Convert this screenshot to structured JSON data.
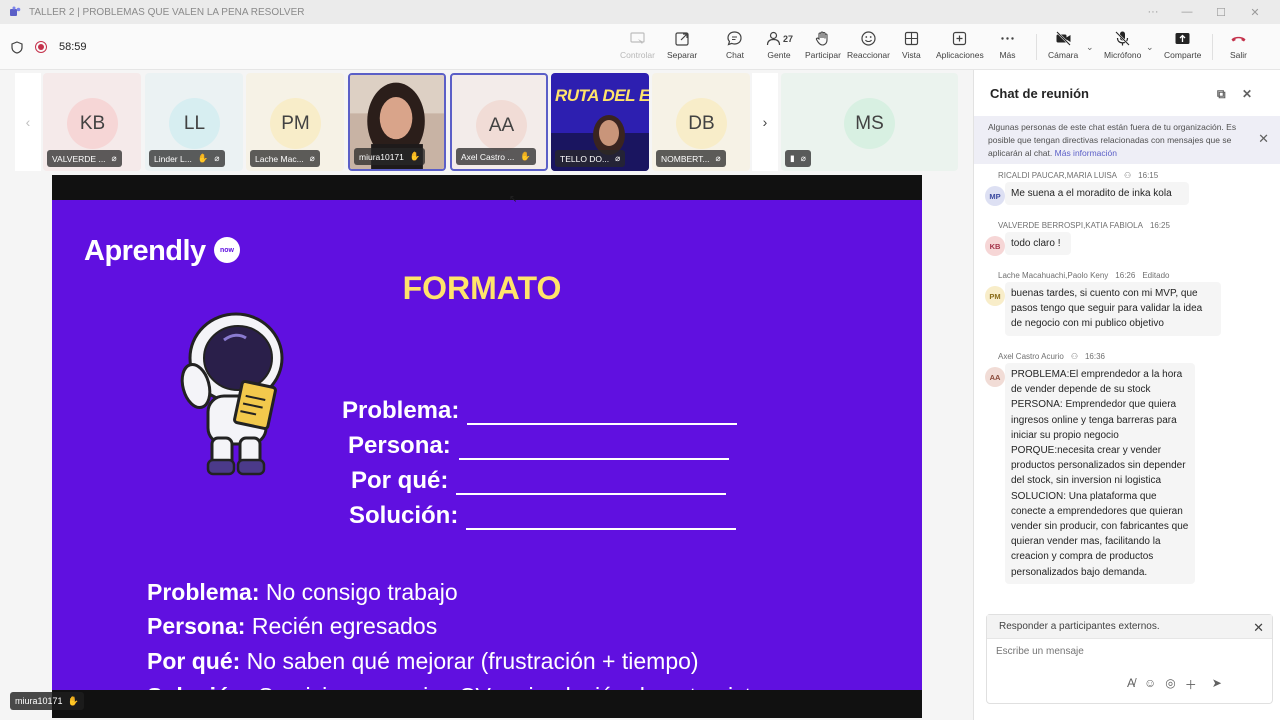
{
  "window": {
    "title": "TALLER 2 | PROBLEMAS QUE VALEN LA PENA RESOLVER"
  },
  "meeting": {
    "timer": "58:59"
  },
  "toolbar": {
    "controlar": "Controlar",
    "separar": "Separar",
    "chat": "Chat",
    "people_count": "27",
    "gente": "Gente",
    "participar": "Participar",
    "reaccionar": "Reaccionar",
    "vista": "Vista",
    "aplicaciones": "Aplicaciones",
    "mas": "Más",
    "camara": "Cámara",
    "microfono": "Micrófono",
    "compartir": "Comparte",
    "salir": "Salir"
  },
  "participants": [
    {
      "initials": "KB",
      "name": "VALVERDE ...",
      "bg": "#f6d6d6"
    },
    {
      "initials": "LL",
      "name": "Linder L...",
      "bg": "#d7eef1"
    },
    {
      "initials": "PM",
      "name": "Lache Mac...",
      "bg": "#f8edc9"
    },
    {
      "initials": "",
      "name": "miura10171",
      "bg": "#c9b7ad"
    },
    {
      "initials": "AA",
      "name": "Axel Castro ...",
      "bg": "#f1dcd6"
    },
    {
      "initials": "",
      "name": "TELLO DO...",
      "bg": "#2d1fb0"
    },
    {
      "initials": "DB",
      "name": "NOMBERT...",
      "bg": "#f8edc9"
    },
    {
      "initials": "MS",
      "name": "",
      "bg": "#d8f0e2"
    }
  ],
  "slide": {
    "logo": "Aprendly",
    "logo_badge": "now",
    "overlay_text": "RUTA DEL EMPRENDEDOR",
    "title": "FORMATO",
    "fields": [
      "Problema:",
      "Persona:",
      "Por qué:",
      "Solución:"
    ],
    "example": [
      {
        "label": "Problema:",
        "value": " No consigo trabajo"
      },
      {
        "label": "Persona:",
        "value": " Recién egresados"
      },
      {
        "label": "Por qué:",
        "value": " No saben qué mejorar (frustración + tiempo)"
      },
      {
        "label": "Solución:",
        "value": " Servicio que revise CV + simulación de entrevista"
      }
    ]
  },
  "presenter": "miura10171",
  "chat": {
    "title": "Chat de reunión",
    "banner_text": "Algunas personas de este chat están fuera de tu organización. Es posible que tengan directivas relacionadas con mensajes que se aplicarán al chat.",
    "banner_link": "Más información",
    "messages": [
      {
        "sender": "RICALDI PAUCAR,MARIA LUISA",
        "time": "16:15",
        "initials": "MP",
        "text": "Me suena a el moradito de inka kola",
        "edited": ""
      },
      {
        "sender": "VALVERDE BERROSPI,KATIA FABIOLA",
        "time": "16:25",
        "initials": "KB",
        "text": "todo claro !",
        "edited": ""
      },
      {
        "sender": "Lache Macahuachi,Paolo Keny",
        "time": "16:26",
        "initials": "PM",
        "text": "buenas tardes, si cuento con  mi MVP, que pasos tengo que seguir para validar la idea de negocio con mi publico objetivo",
        "edited": "Editado"
      },
      {
        "sender": "Axel Castro Acurio",
        "time": "16:36",
        "initials": "AA",
        "text": "PROBLEMA:El emprendedor a la hora de vender depende de su stock PERSONA: Emprendedor que quiera ingresos online y tenga barreras para iniciar su propio negocio PORQUE:necesita crear y vender productos personalizados sin depender del stock, sin inversion ni logistica SOLUCION: Una plataforma que conecte a emprendedores que quieran vender sin producir, con fabricantes que quieran vender mas, facilitando la creacion y compra de productos personalizados bajo demanda.",
        "edited": ""
      }
    ],
    "reply_to": "Responder a participantes externos.",
    "input_placeholder": "Escribe un mensaje"
  }
}
